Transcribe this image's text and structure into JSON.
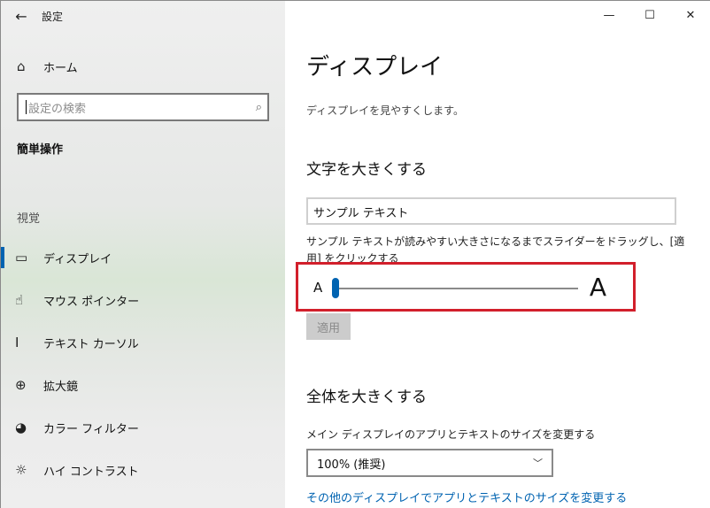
{
  "window": {
    "title": "設定",
    "back_icon": "←",
    "minimize_icon": "—",
    "maximize_icon": "☐",
    "close_icon": "✕"
  },
  "sidebar": {
    "home": {
      "icon": "home-icon",
      "glyph": "⌂",
      "label": "ホーム"
    },
    "search": {
      "placeholder": "設定の検索",
      "icon_glyph": "⌕"
    },
    "category": "簡単操作",
    "group_label": "視覚",
    "items": [
      {
        "id": "display",
        "label": "ディスプレイ",
        "glyph": "▭",
        "active": true
      },
      {
        "id": "mouse-pointer",
        "label": "マウス ポインター",
        "glyph": "☝",
        "active": false
      },
      {
        "id": "text-cursor",
        "label": "テキスト カーソル",
        "glyph": "I",
        "active": false
      },
      {
        "id": "magnifier",
        "label": "拡大鏡",
        "glyph": "⊕",
        "active": false
      },
      {
        "id": "color-filter",
        "label": "カラー フィルター",
        "glyph": "◕",
        "active": false
      },
      {
        "id": "high-contrast",
        "label": "ハイ コントラスト",
        "glyph": "☼",
        "active": false
      }
    ]
  },
  "main": {
    "title": "ディスプレイ",
    "description": "ディスプレイを見やすくします。",
    "text_section": {
      "heading": "文字を大きくする",
      "sample_text": "サンプル テキスト",
      "instruction": "サンプル テキストが読みやすい大きさになるまでスライダーをドラッグし、[適用] をクリックする",
      "slider_small_label": "A",
      "slider_large_label": "A",
      "slider_value": 0.0,
      "apply_label": "適用"
    },
    "scale_section": {
      "heading": "全体を大きくする",
      "dropdown_label": "メイン ディスプレイのアプリとテキストのサイズを変更する",
      "dropdown_value": "100% (推奨)",
      "link_text": "その他のディスプレイでアプリとテキストのサイズを変更する"
    }
  },
  "colors": {
    "accent": "#0063b1",
    "highlight_border": "#d21f2b"
  }
}
